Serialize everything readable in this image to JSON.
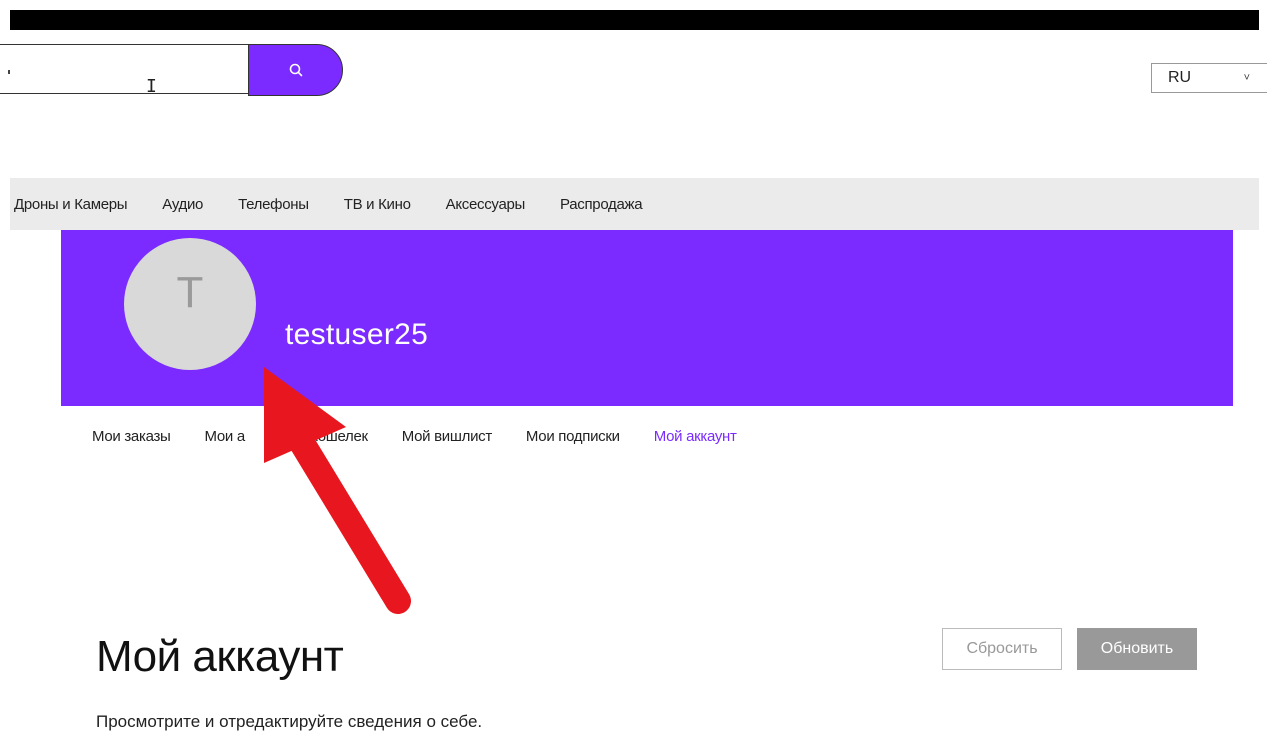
{
  "search": {
    "value": "",
    "placeholder": "",
    "button_icon": "search-icon"
  },
  "language": {
    "selected": "RU"
  },
  "nav": {
    "items": [
      {
        "label": "Дроны и Камеры"
      },
      {
        "label": "Аудио"
      },
      {
        "label": "Телефоны"
      },
      {
        "label": "ТВ и Кино"
      },
      {
        "label": "Аксессуары"
      },
      {
        "label": "Распродажа"
      }
    ]
  },
  "profile": {
    "avatar_letter": "T",
    "username": "testuser25"
  },
  "account_nav": {
    "items": [
      {
        "label": "Мои заказы"
      },
      {
        "label": "Мои а"
      },
      {
        "label": "Мой кошелек"
      },
      {
        "label": "Мой вишлист"
      },
      {
        "label": "Мои подписки"
      },
      {
        "label": "Мой аккаунт",
        "active": true
      }
    ]
  },
  "account": {
    "title": "Мой аккаунт",
    "description": "Просмотрите и отредактируйте сведения о себе.",
    "reset_label": "Сбросить",
    "update_label": "Обновить"
  },
  "colors": {
    "accent": "#7b2bff",
    "nav_bg": "#ebebeb",
    "annotation_arrow": "#e8161e"
  }
}
